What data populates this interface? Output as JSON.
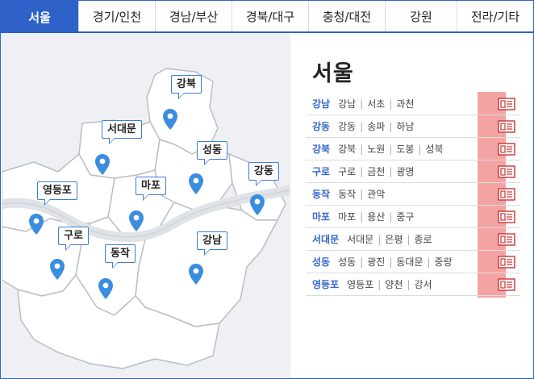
{
  "tabs": [
    {
      "label": "서울",
      "active": true
    },
    {
      "label": "경기/인천",
      "active": false
    },
    {
      "label": "경남/부산",
      "active": false
    },
    {
      "label": "경북/대구",
      "active": false
    },
    {
      "label": "충청/대전",
      "active": false
    },
    {
      "label": "강원",
      "active": false
    },
    {
      "label": "전라/기타",
      "active": false
    }
  ],
  "map": {
    "labels": [
      "강북",
      "서대문",
      "성동",
      "강동",
      "영등포",
      "마포",
      "구로",
      "동작",
      "강남"
    ]
  },
  "panel": {
    "title": "서울",
    "rows": [
      {
        "key": "강남",
        "subs": [
          "강남",
          "서초",
          "과천"
        ]
      },
      {
        "key": "강동",
        "subs": [
          "강동",
          "송파",
          "하남"
        ]
      },
      {
        "key": "강북",
        "subs": [
          "강북",
          "노원",
          "도봉",
          "성북"
        ]
      },
      {
        "key": "구로",
        "subs": [
          "구로",
          "금천",
          "광명"
        ]
      },
      {
        "key": "동작",
        "subs": [
          "동작",
          "관악"
        ]
      },
      {
        "key": "마포",
        "subs": [
          "마포",
          "용산",
          "중구"
        ]
      },
      {
        "key": "서대문",
        "subs": [
          "서대문",
          "은평",
          "종로"
        ]
      },
      {
        "key": "성동",
        "subs": [
          "성동",
          "광진",
          "동대문",
          "중랑"
        ]
      },
      {
        "key": "영등포",
        "subs": [
          "영등포",
          "양천",
          "강서"
        ]
      }
    ]
  },
  "colors": {
    "accent": "#2f62c9",
    "pin": "#3b8de0",
    "highlight": "#f4a3a3"
  },
  "icons": {
    "row_button": "newspaper-icon",
    "map_pin": "map-pin-icon"
  }
}
